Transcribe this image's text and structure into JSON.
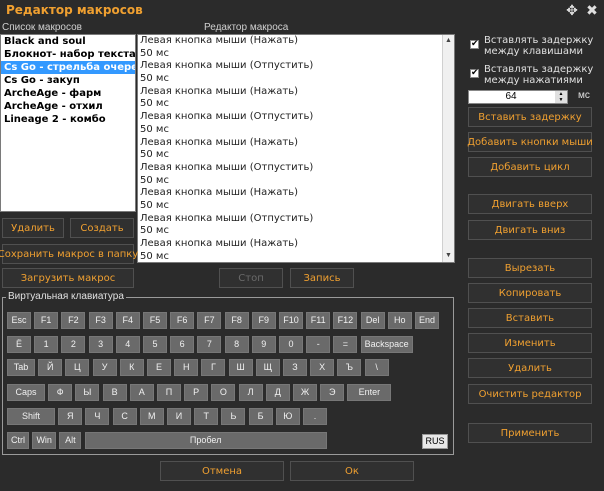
{
  "window": {
    "title": "Редактор макросов",
    "move_icon": "move-icon",
    "close_icon": "close-icon"
  },
  "labels": {
    "macro_list": "Список макросов",
    "editor": "Редактор макроса",
    "keyboard": "Виртуальная клавиатура",
    "ms": "мс"
  },
  "macros": [
    "Black and soul",
    "Блокнот- набор текста",
    "Cs Go - стрельба очере",
    "Cs Go - закуп",
    "ArcheAge - фарм",
    "ArcheAge - отхил",
    "Lineage 2 - комбо"
  ],
  "selected_macro_index": 2,
  "editor_lines": [
    "Левая кнопка мыши (Нажать)",
    "50 мс",
    "Левая кнопка мыши (Отпустить)",
    "50 мс",
    "Левая кнопка мыши (Нажать)",
    "50 мс",
    "Левая кнопка мыши (Отпустить)",
    "50 мс",
    "Левая кнопка мыши (Нажать)",
    "50 мс",
    "Левая кнопка мыши (Отпустить)",
    "50 мс",
    "Левая кнопка мыши (Нажать)",
    "50 мс",
    "Левая кнопка мыши (Отпустить)",
    "50 мс",
    "Левая кнопка мыши (Нажать)",
    "50 мс"
  ],
  "left_buttons": {
    "delete": "Удалить",
    "create": "Создать",
    "save_macro": "Сохранить макрос в папку",
    "load_macro": "Загрузить макрос",
    "stop": "Стоп",
    "record": "Запись"
  },
  "options": {
    "delay_keys": "Вставлять задержку\nмежду клавишами",
    "delay_clicks": "Вставлять задержку\nмежду нажатиями",
    "delay_value": "64"
  },
  "right_buttons": {
    "insert_delay": "Вставить задержку",
    "add_mouse": "Добавить кнопки мыши",
    "add_loop": "Добавить цикл",
    "move_up": "Двигать вверх",
    "move_down": "Двигать вниз",
    "cut": "Вырезать",
    "copy": "Копировать",
    "paste": "Вставить",
    "modify": "Изменить",
    "remove": "Удалить",
    "clear_editor": "Очистить редактор",
    "apply": "Применить"
  },
  "bottom_buttons": {
    "cancel": "Отмена",
    "ok": "Ок"
  },
  "keyboard": {
    "row1": [
      "Esc",
      "F1",
      "F2",
      "F3",
      "F4",
      "F5",
      "F6",
      "F7",
      "F8",
      "F9",
      "F10",
      "F11",
      "F12",
      "Del",
      "Ho",
      "End"
    ],
    "row2": [
      "Ё",
      "1",
      "2",
      "3",
      "4",
      "5",
      "6",
      "7",
      "8",
      "9",
      "0",
      "-",
      "=",
      "Backspace"
    ],
    "row3": [
      "Tab",
      "Й",
      "Ц",
      "У",
      "К",
      "Е",
      "Н",
      "Г",
      "Ш",
      "Щ",
      "З",
      "Х",
      "Ъ",
      "\\"
    ],
    "row4": [
      "Caps",
      "Ф",
      "Ы",
      "В",
      "А",
      "П",
      "Р",
      "О",
      "Л",
      "Д",
      "Ж",
      "Э",
      "Enter"
    ],
    "row5": [
      "Shift",
      "Я",
      "Ч",
      "С",
      "М",
      "И",
      "Т",
      "Ь",
      "Б",
      "Ю",
      "."
    ],
    "row6": [
      "Ctrl",
      "Win",
      "Alt",
      "Пробел"
    ],
    "rus": "RUS"
  },
  "colors": {
    "accent": "#f0a030",
    "background": "#2b2b2b",
    "selection": "#3399ff",
    "key": "#6a6a6a"
  }
}
